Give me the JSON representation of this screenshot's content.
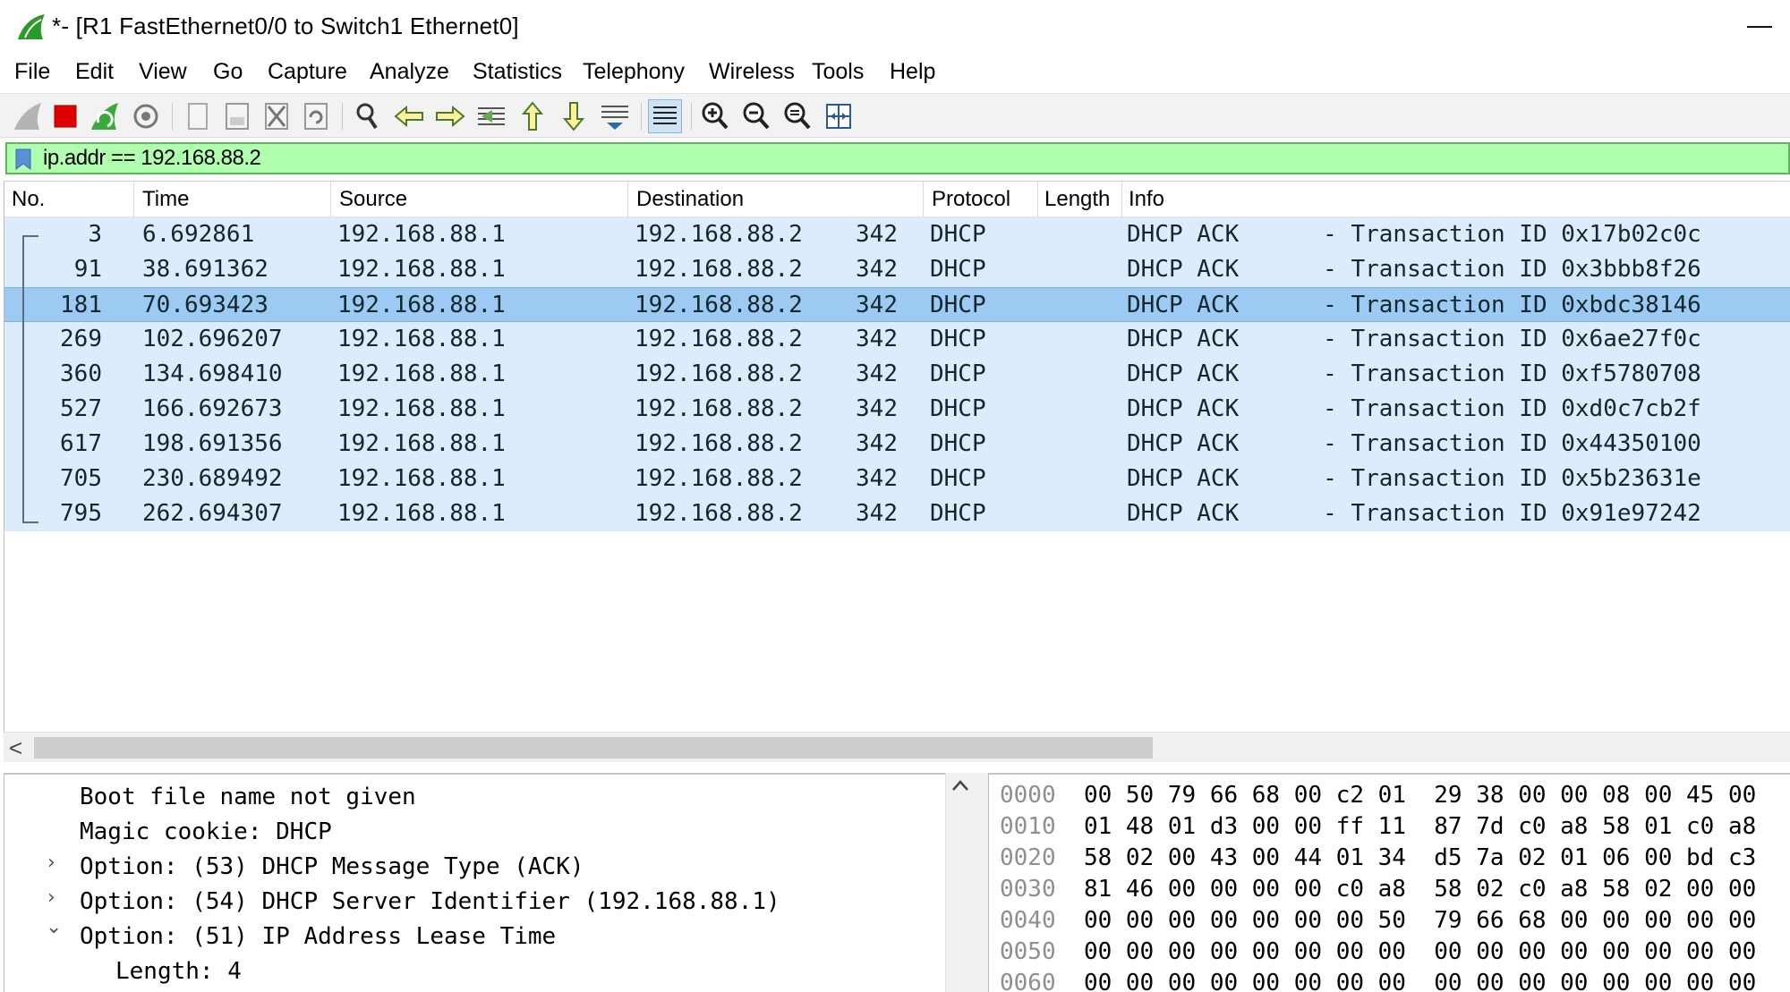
{
  "window": {
    "title": "*- [R1 FastEthernet0/0 to Switch1 Ethernet0]",
    "minimize_glyph": "—"
  },
  "menu": [
    "File",
    "Edit",
    "View",
    "Go",
    "Capture",
    "Analyze",
    "Statistics",
    "Telephony",
    "Wireless",
    "Tools",
    "Help"
  ],
  "toolbar": {
    "icons": [
      "shark-fin-start-icon",
      "stop-capture-icon",
      "restart-capture-icon",
      "capture-options-icon",
      "open-file-icon",
      "save-file-icon",
      "close-file-icon",
      "reload-file-icon",
      "find-packet-icon",
      "go-back-icon",
      "go-forward-icon",
      "go-to-packet-icon",
      "go-first-icon",
      "go-last-icon",
      "auto-scroll-icon",
      "colorize-icon",
      "zoom-in-icon",
      "zoom-out-icon",
      "zoom-normal-icon",
      "resize-columns-icon"
    ]
  },
  "filter": {
    "value": "ip.addr == 192.168.88.2"
  },
  "packet_list": {
    "columns": [
      "No.",
      "Time",
      "Source",
      "Destination",
      "Protocol",
      "Length",
      "Info"
    ],
    "rows": [
      {
        "no": "3",
        "time": "6.692861",
        "src": "192.168.88.1",
        "dst": "192.168.88.2",
        "proto": "DHCP",
        "len": "342",
        "info": "DHCP ACK      - Transaction ID 0x17b02c0c"
      },
      {
        "no": "91",
        "time": "38.691362",
        "src": "192.168.88.1",
        "dst": "192.168.88.2",
        "proto": "DHCP",
        "len": "342",
        "info": "DHCP ACK      - Transaction ID 0x3bbb8f26"
      },
      {
        "no": "181",
        "time": "70.693423",
        "src": "192.168.88.1",
        "dst": "192.168.88.2",
        "proto": "DHCP",
        "len": "342",
        "info": "DHCP ACK      - Transaction ID 0xbdc38146"
      },
      {
        "no": "269",
        "time": "102.696207",
        "src": "192.168.88.1",
        "dst": "192.168.88.2",
        "proto": "DHCP",
        "len": "342",
        "info": "DHCP ACK      - Transaction ID 0x6ae27f0c"
      },
      {
        "no": "360",
        "time": "134.698410",
        "src": "192.168.88.1",
        "dst": "192.168.88.2",
        "proto": "DHCP",
        "len": "342",
        "info": "DHCP ACK      - Transaction ID 0xf5780708"
      },
      {
        "no": "527",
        "time": "166.692673",
        "src": "192.168.88.1",
        "dst": "192.168.88.2",
        "proto": "DHCP",
        "len": "342",
        "info": "DHCP ACK      - Transaction ID 0xd0c7cb2f"
      },
      {
        "no": "617",
        "time": "198.691356",
        "src": "192.168.88.1",
        "dst": "192.168.88.2",
        "proto": "DHCP",
        "len": "342",
        "info": "DHCP ACK      - Transaction ID 0x44350100"
      },
      {
        "no": "705",
        "time": "230.689492",
        "src": "192.168.88.1",
        "dst": "192.168.88.2",
        "proto": "DHCP",
        "len": "342",
        "info": "DHCP ACK      - Transaction ID 0x5b23631e"
      },
      {
        "no": "795",
        "time": "262.694307",
        "src": "192.168.88.1",
        "dst": "192.168.88.2",
        "proto": "DHCP",
        "len": "342",
        "info": "DHCP ACK      - Transaction ID 0x91e97242"
      }
    ],
    "selected_index": 2
  },
  "scrollbar": {
    "left_arrow": "<",
    "up_arrow": "^"
  },
  "details": [
    {
      "text": "Boot file name not given",
      "expander": ""
    },
    {
      "text": "Magic cookie: DHCP",
      "expander": ""
    },
    {
      "text": "Option: (53) DHCP Message Type (ACK)",
      "expander": "›"
    },
    {
      "text": "Option: (54) DHCP Server Identifier (192.168.88.1)",
      "expander": "›"
    },
    {
      "text": "Option: (51) IP Address Lease Time",
      "expander": "⌄"
    },
    {
      "text": "Length: 4",
      "expander": ""
    }
  ],
  "hex": [
    {
      "offset": "0000",
      "bytes": "00 50 79 66 68 00 c2 01  29 38 00 00 08 00 45 00"
    },
    {
      "offset": "0010",
      "bytes": "01 48 01 d3 00 00 ff 11  87 7d c0 a8 58 01 c0 a8"
    },
    {
      "offset": "0020",
      "bytes": "58 02 00 43 00 44 01 34  d5 7a 02 01 06 00 bd c3"
    },
    {
      "offset": "0030",
      "bytes": "81 46 00 00 00 00 c0 a8  58 02 c0 a8 58 02 00 00"
    },
    {
      "offset": "0040",
      "bytes": "00 00 00 00 00 00 00 50  79 66 68 00 00 00 00 00"
    },
    {
      "offset": "0050",
      "bytes": "00 00 00 00 00 00 00 00  00 00 00 00 00 00 00 00"
    },
    {
      "offset": "0060",
      "bytes": "00 00 00 00 00 00 00 00  00 00 00 00 00 00 00 00"
    }
  ],
  "colors": {
    "filter_bg": "#afffaf",
    "row_bg": "#dcecfc",
    "row_selected_bg": "#9dcaf2",
    "stop_red": "#e00000"
  }
}
